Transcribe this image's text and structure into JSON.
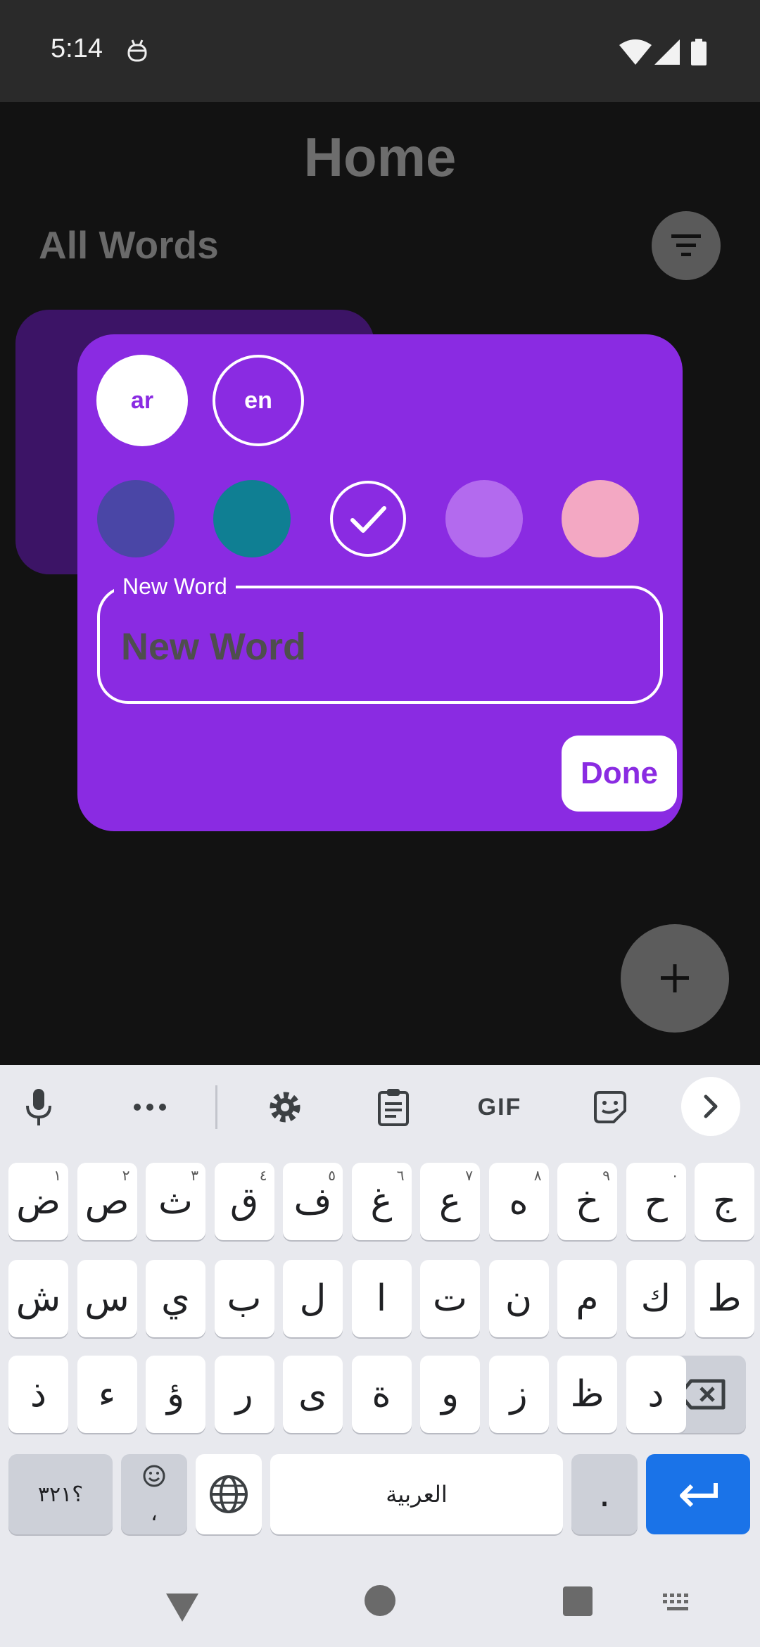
{
  "status_bar": {
    "time": "5:14"
  },
  "app": {
    "title": "Home",
    "section_title": "All Words"
  },
  "dialog": {
    "languages": [
      {
        "code": "ar",
        "selected": true
      },
      {
        "code": "en",
        "selected": false
      }
    ],
    "colors": [
      {
        "hex": "#4a46a6",
        "selected": false
      },
      {
        "hex": "#0f7f93",
        "selected": false
      },
      {
        "hex": "#8a2be2",
        "selected": true
      },
      {
        "hex": "#b36aee",
        "selected": false
      },
      {
        "hex": "#f3a8c3",
        "selected": false
      }
    ],
    "field_label": "New Word",
    "field_placeholder": "New Word",
    "field_value": "",
    "done_label": "Done"
  },
  "keyboard": {
    "toolbar": [
      "mic-icon",
      "more-icon",
      "settings-icon",
      "clipboard-icon",
      "GIF",
      "sticker-icon",
      "chevron-right-icon"
    ],
    "row1": [
      {
        "k": "ض",
        "h": "١"
      },
      {
        "k": "ص",
        "h": "٢"
      },
      {
        "k": "ث",
        "h": "٣"
      },
      {
        "k": "ق",
        "h": "٤"
      },
      {
        "k": "ف",
        "h": "٥"
      },
      {
        "k": "غ",
        "h": "٦"
      },
      {
        "k": "ع",
        "h": "٧"
      },
      {
        "k": "ه",
        "h": "٨"
      },
      {
        "k": "خ",
        "h": "٩"
      },
      {
        "k": "ح",
        "h": "٠"
      },
      {
        "k": "ج",
        "h": ""
      }
    ],
    "row2": [
      "ش",
      "س",
      "ي",
      "ب",
      "ل",
      "ا",
      "ت",
      "ن",
      "م",
      "ك",
      "ط"
    ],
    "row3": [
      "ذ",
      "ء",
      "ؤ",
      "ر",
      "ى",
      "ة",
      "و",
      "ز",
      "ظ",
      "د"
    ],
    "symbols_label": "؟٣٢١",
    "comma_label": "،",
    "space_label": "العربية",
    "period_label": ".",
    "accent_colors": {
      "enter": "#1a73e8",
      "dialog": "#8a2be2"
    }
  }
}
